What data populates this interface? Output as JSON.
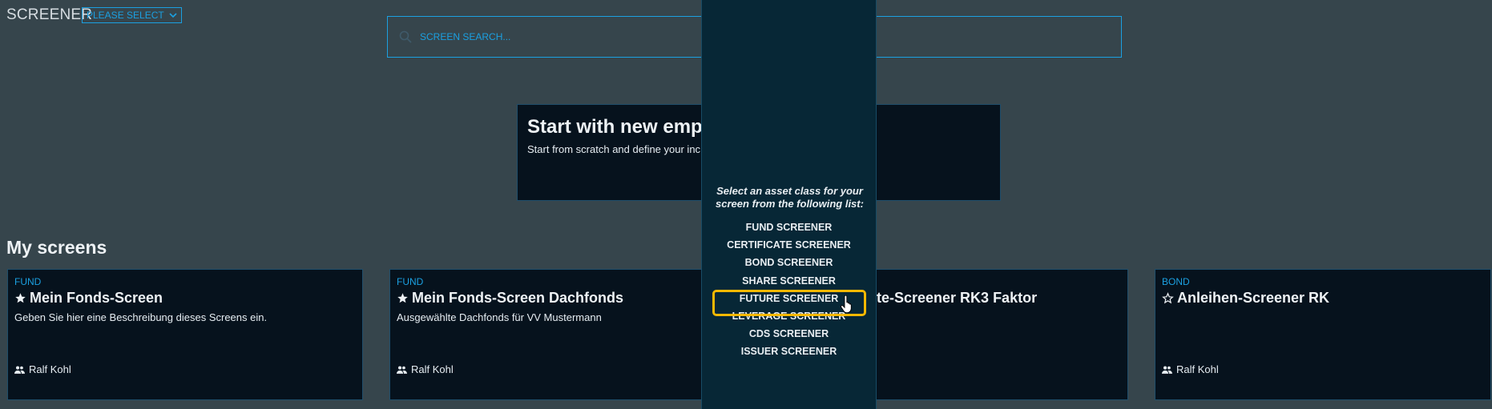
{
  "header": {
    "title": "SCREENER",
    "asset_select": {
      "value": "PLEASE SELECT"
    }
  },
  "search": {
    "placeholder": "SCREEN SEARCH..."
  },
  "new_screen": {
    "title": "Start with new empty s",
    "description": "Start from scratch and define your inc"
  },
  "my_screens": {
    "heading": "My screens",
    "cards": [
      {
        "type": "FUND",
        "starred": true,
        "title": "Mein Fonds-Screen",
        "description": "Geben Sie hier eine Beschreibung dieses Screens ein.",
        "owner": "Ralf Kohl"
      },
      {
        "type": "FUND",
        "starred": true,
        "title": "Mein Fonds-Screen Dachfonds",
        "description": "Ausgewählte Dachfonds für VV Mustermann",
        "owner": "Ralf Kohl"
      },
      {
        "type": "",
        "starred": false,
        "title": "te-Screener RK3 Faktor",
        "description": "",
        "owner": ""
      },
      {
        "type": "BOND",
        "starred": false,
        "title": "Anleihen-Screener RK",
        "description": "",
        "owner": "Ralf Kohl"
      }
    ]
  },
  "dropdown": {
    "instructions": "Select an asset class for your screen from the following list:",
    "items": [
      "FUND SCREENER",
      "CERTIFICATE SCREENER",
      "BOND SCREENER",
      "SHARE SCREENER",
      "FUTURE SCREENER",
      "LEVERAGE SCREENER",
      "CDS SCREENER",
      "ISSUER SCREENER"
    ],
    "highlighted_item": "FUTURE SCREENER"
  },
  "colors": {
    "background": "#36454c",
    "card_background": "#06121d",
    "accent": "#1ba0e1",
    "dropdown_background": "#072736",
    "highlight": "#f5b800"
  }
}
